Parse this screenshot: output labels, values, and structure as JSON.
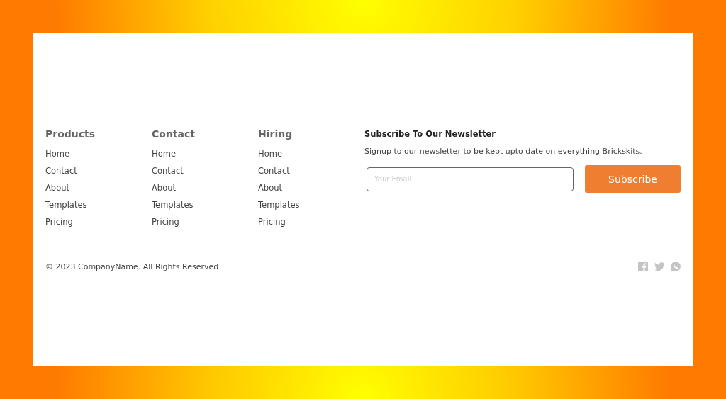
{
  "columns": [
    {
      "title": "Products",
      "links": [
        "Home",
        "Contact",
        "About",
        "Templates",
        "Pricing"
      ]
    },
    {
      "title": "Contact",
      "links": [
        "Home",
        "Contact",
        "About",
        "Templates",
        "Pricing"
      ]
    },
    {
      "title": "Hiring",
      "links": [
        "Home",
        "Contact",
        "About",
        "Templates",
        "Pricing"
      ]
    }
  ],
  "newsletter": {
    "title": "Subscribe To Our Newsletter",
    "text": "Signup to our newsletter to be kept upto date on everything Brickskits.",
    "email": {
      "placeholder": "Your Email"
    },
    "button": "Subscribe"
  },
  "copyright": "© 2023 CompanyName. All Rights Reserved",
  "social": [
    {
      "kind": "facebook"
    },
    {
      "kind": "twitter"
    },
    {
      "kind": "whatsapp"
    }
  ]
}
